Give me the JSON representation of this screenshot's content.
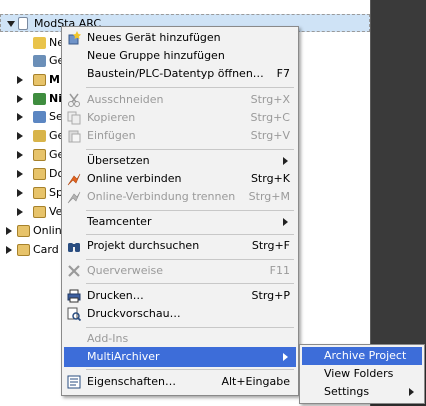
{
  "tree": {
    "root_label": "ModSta ARC",
    "row_labels": [
      "Ne",
      "Ge",
      "M",
      "Ni",
      "Se",
      "Ge",
      "Ge",
      "Do",
      "Sp",
      "Ve",
      "Onlin",
      "Card"
    ]
  },
  "menu": {
    "items": [
      {
        "label": "Neues Gerät hinzufügen",
        "shortcut": "",
        "icon": "add-device-icon"
      },
      {
        "label": "Neue Gruppe hinzufügen",
        "shortcut": "",
        "icon": ""
      },
      {
        "label": "Baustein/PLC-Datentyp öffnen…",
        "shortcut": "F7",
        "icon": ""
      },
      {
        "label": "Ausschneiden",
        "shortcut": "Strg+X",
        "icon": "scissors-icon"
      },
      {
        "label": "Kopieren",
        "shortcut": "Strg+C",
        "icon": "copy-icon"
      },
      {
        "label": "Einfügen",
        "shortcut": "Strg+V",
        "icon": "paste-icon"
      },
      {
        "label": "Übersetzen",
        "shortcut": "",
        "icon": ""
      },
      {
        "label": "Online verbinden",
        "shortcut": "Strg+K",
        "icon": "go-online-icon"
      },
      {
        "label": "Online-Verbindung trennen",
        "shortcut": "Strg+M",
        "icon": "go-offline-icon"
      },
      {
        "label": "Teamcenter",
        "shortcut": "",
        "icon": ""
      },
      {
        "label": "Projekt durchsuchen",
        "shortcut": "Strg+F",
        "icon": "binoculars-icon"
      },
      {
        "label": "Querverweise",
        "shortcut": "F11",
        "icon": "cross-reference-icon"
      },
      {
        "label": "Drucken…",
        "shortcut": "Strg+P",
        "icon": "printer-icon"
      },
      {
        "label": "Druckvorschau…",
        "shortcut": "",
        "icon": "print-preview-icon"
      },
      {
        "label": "Add-Ins",
        "shortcut": "",
        "icon": ""
      },
      {
        "label": "MultiArchiver",
        "shortcut": "",
        "icon": ""
      },
      {
        "label": "Eigenschaften…",
        "shortcut": "Alt+Eingabe",
        "icon": "properties-icon"
      }
    ]
  },
  "submenu": {
    "items": [
      {
        "label": "Archive Project"
      },
      {
        "label": "View Folders"
      },
      {
        "label": "Settings"
      }
    ]
  },
  "colors": {
    "highlight": "#3d6dd9",
    "menu_bg": "#f2f2f2",
    "disabled_text": "#9a9a9a"
  }
}
